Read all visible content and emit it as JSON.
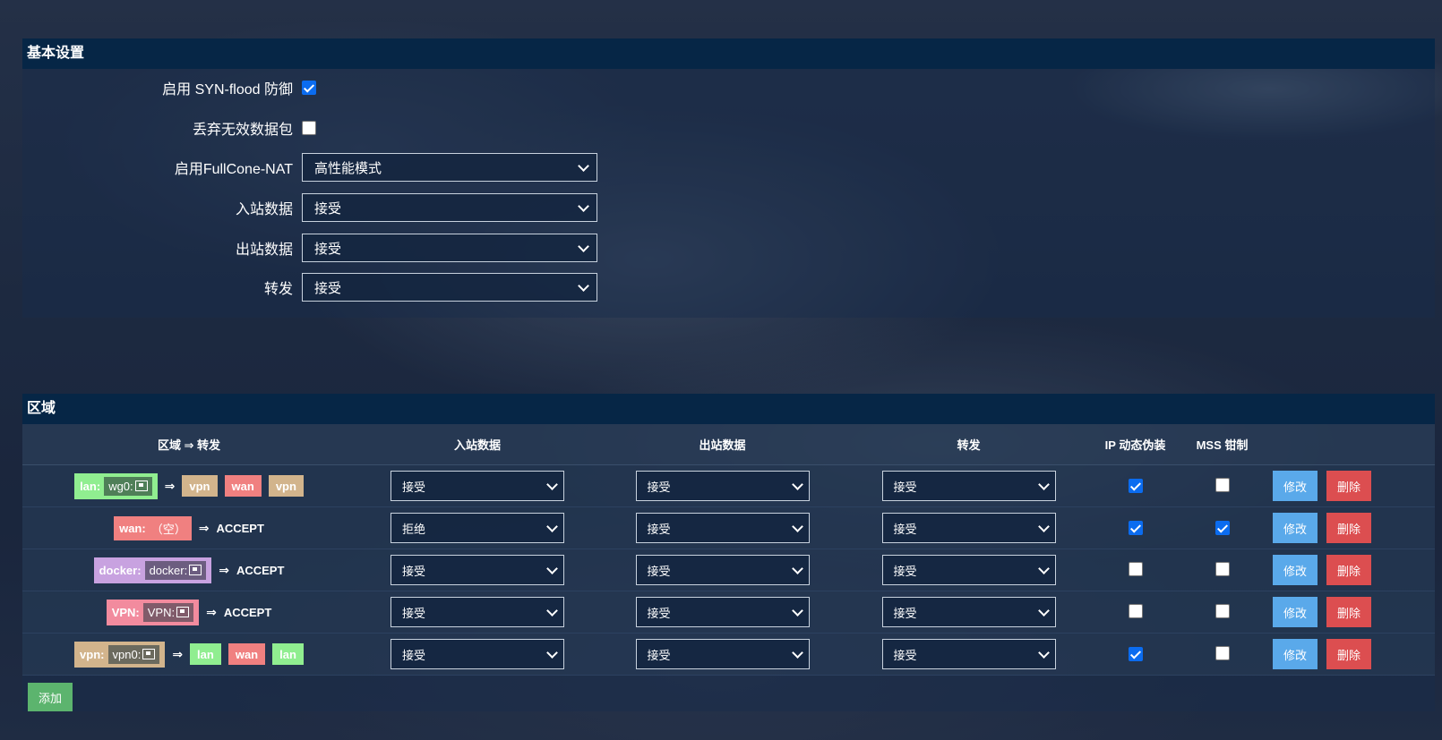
{
  "basic": {
    "title": "基本设置",
    "syn_flood_label": "启用 SYN-flood 防御",
    "syn_flood_checked": true,
    "drop_invalid_label": "丢弃无效数据包",
    "drop_invalid_checked": false,
    "fullcone_label": "启用FullCone-NAT",
    "fullcone_value": "高性能模式",
    "input_label": "入站数据",
    "input_value": "接受",
    "output_label": "出站数据",
    "output_value": "接受",
    "forward_label": "转发",
    "forward_value": "接受"
  },
  "zones": {
    "title": "区域",
    "headers": [
      "区域 ⇒ 转发",
      "入站数据",
      "出站数据",
      "转发",
      "IP 动态伪装",
      "MSS 钳制",
      ""
    ],
    "arrow": "⇒",
    "edit_label": "修改",
    "delete_label": "删除",
    "add_label": "添加",
    "rows": [
      {
        "zone": "lan:",
        "iface": "wg0:",
        "zone_color": "#90ee90",
        "iface_color": "#4f7f58",
        "forwards": [
          {
            "name": "vpn",
            "color": "#d2b48c"
          },
          {
            "name": "wan",
            "color": "#f08080"
          },
          {
            "name": "vpn",
            "color": "#d2b48c"
          }
        ],
        "forward_text": "",
        "input": "接受",
        "output": "接受",
        "forward": "接受",
        "masq": true,
        "mss": false
      },
      {
        "zone": "wan:",
        "iface": "（空）",
        "zone_color": "#f08080",
        "iface_color": "",
        "forwards": [],
        "forward_text": "ACCEPT",
        "input": "拒绝",
        "output": "接受",
        "forward": "接受",
        "masq": true,
        "mss": true
      },
      {
        "zone": "docker:",
        "iface": "docker:",
        "zone_color": "#c8a2e0",
        "iface_color": "#6c5d80",
        "forwards": [],
        "forward_text": "ACCEPT",
        "input": "接受",
        "output": "接受",
        "forward": "接受",
        "masq": false,
        "mss": false
      },
      {
        "zone": "VPN:",
        "iface": "VPN:",
        "zone_color": "#f28b9e",
        "iface_color": "#805b6a",
        "forwards": [],
        "forward_text": "ACCEPT",
        "input": "接受",
        "output": "接受",
        "forward": "接受",
        "masq": false,
        "mss": false
      },
      {
        "zone": "vpn:",
        "iface": "vpn0:",
        "zone_color": "#d2b48c",
        "iface_color": "#6b6a5e",
        "forwards": [
          {
            "name": "lan",
            "color": "#90ee90"
          },
          {
            "name": "wan",
            "color": "#f08080"
          },
          {
            "name": "lan",
            "color": "#90ee90"
          }
        ],
        "forward_text": "",
        "input": "接受",
        "output": "接受",
        "forward": "接受",
        "masq": true,
        "mss": false
      }
    ]
  },
  "icons": {
    "select_arrow": "chevron-down-icon",
    "iface_icon": "network-port-icon"
  }
}
